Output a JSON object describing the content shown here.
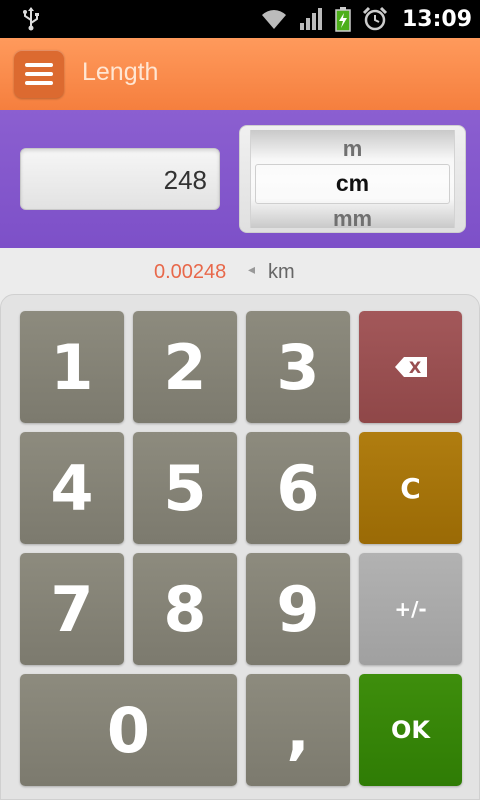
{
  "status_bar": {
    "time": "13:09",
    "icons": [
      "usb-icon",
      "wifi-icon",
      "signal-icon",
      "battery-charging-icon",
      "alarm-icon"
    ]
  },
  "action_bar": {
    "title": "Length",
    "menu_icon": "hamburger-menu-icon"
  },
  "converter": {
    "input_value": "248",
    "unit_picker": {
      "above": "m",
      "selected": "cm",
      "below": "mm"
    }
  },
  "result": {
    "value": "0.00248",
    "arrow": "◂",
    "unit": "km"
  },
  "keypad": {
    "keys": {
      "k1": "1",
      "k2": "2",
      "k3": "3",
      "k4": "4",
      "k5": "5",
      "k6": "6",
      "k7": "7",
      "k8": "8",
      "k9": "9",
      "k0": "0",
      "comma": ",",
      "clear": "C",
      "sign": "+/-",
      "ok": "OK",
      "backspace_label": "X"
    }
  },
  "colors": {
    "action_bar": "#f68645",
    "converter_bg": "#8258cc",
    "result_value": "#e8684a",
    "digit_key": "#858376",
    "backspace_key": "#994f51",
    "clear_key": "#a5730a",
    "sign_key": "#a9a9a9",
    "ok_key": "#378508"
  }
}
